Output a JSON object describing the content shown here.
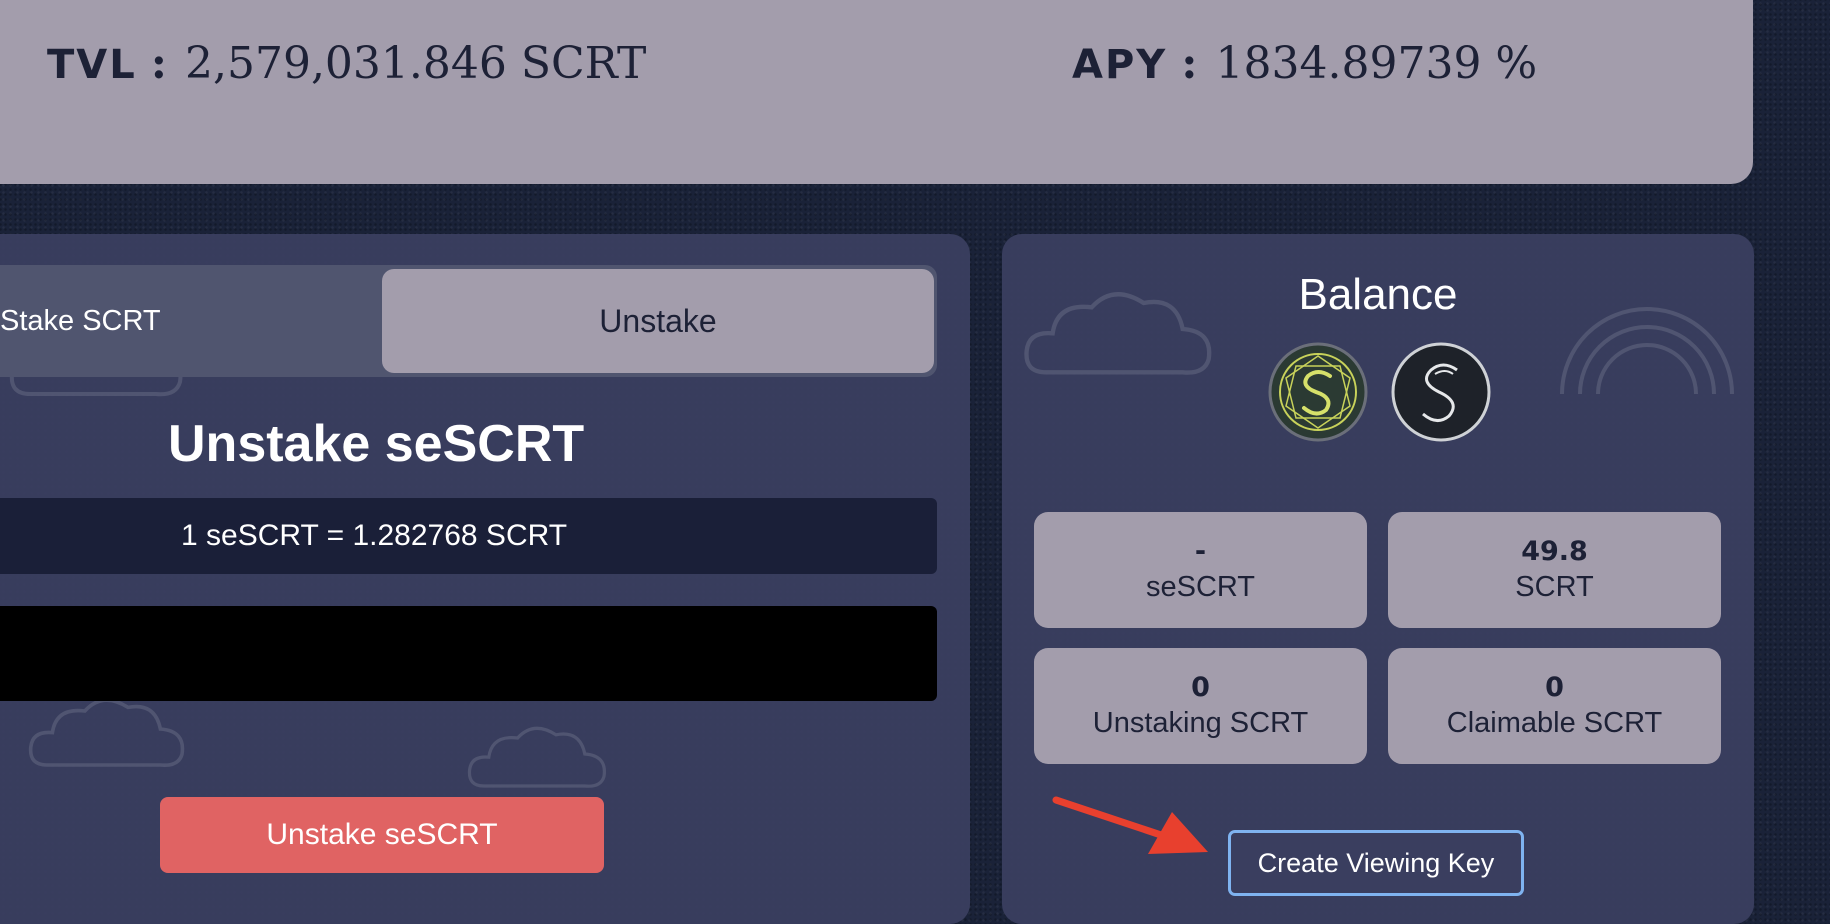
{
  "stats": {
    "tvl_label": "TVL",
    "tvl_value": "2,579,031.846 SCRT",
    "apy_label": "APY",
    "apy_value": "1834.89739 %",
    "separator": ":"
  },
  "tabs": [
    {
      "label": "Stake SCRT",
      "active": false
    },
    {
      "label": "Unstake",
      "active": true
    }
  ],
  "unstake": {
    "title": "Unstake seSCRT",
    "rate": "1 seSCRT = 1.282768 SCRT",
    "amount_value": "",
    "amount_placeholder": "",
    "button_label": "Unstake seSCRT"
  },
  "balance": {
    "title": "Balance",
    "icons": [
      "sescrt-token-icon",
      "scrt-token-icon"
    ],
    "cards": [
      {
        "value": "-",
        "unit": "seSCRT"
      },
      {
        "value": "49.8",
        "unit": "SCRT"
      },
      {
        "value": "0",
        "unit": "Unstaking SCRT"
      },
      {
        "value": "0",
        "unit": "Claimable SCRT"
      }
    ],
    "viewing_key_button": "Create Viewing Key"
  },
  "colors": {
    "banner": "#a39dac",
    "panel": "#3a3e5f",
    "dark_navy": "#1d2136",
    "unstake_button": "#e06363",
    "viewing_key_border": "#7fb3f0",
    "annotation_arrow": "#e8402e"
  }
}
